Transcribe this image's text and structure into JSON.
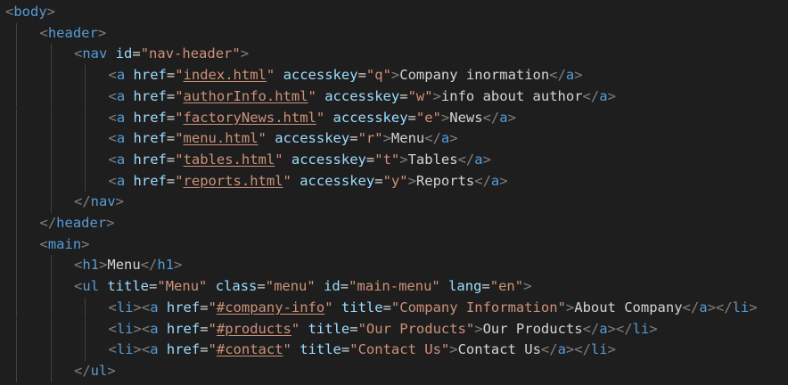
{
  "editor": {
    "theme_colors": {
      "background": "#1e1e1e",
      "bracket": "#808080",
      "tag": "#569cd6",
      "attribute": "#9cdcfe",
      "string": "#ce9178",
      "text": "#d4d4d4",
      "indent_guide": "#404040"
    },
    "lines": [
      {
        "indent": 0,
        "tokens": [
          [
            "b",
            "<"
          ],
          [
            "tag",
            "body"
          ],
          [
            "b",
            ">"
          ]
        ]
      },
      {
        "indent": 1,
        "tokens": [
          [
            "b",
            "<"
          ],
          [
            "tag",
            "header"
          ],
          [
            "b",
            ">"
          ]
        ]
      },
      {
        "indent": 2,
        "tokens": [
          [
            "b",
            "<"
          ],
          [
            "tag",
            "nav"
          ],
          [
            "text",
            " "
          ],
          [
            "attr",
            "id"
          ],
          [
            "text",
            "="
          ],
          [
            "str",
            "\"nav-header\""
          ],
          [
            "b",
            ">"
          ]
        ]
      },
      {
        "indent": 3,
        "tokens": [
          [
            "b",
            "<"
          ],
          [
            "tag",
            "a"
          ],
          [
            "text",
            " "
          ],
          [
            "attr",
            "href"
          ],
          [
            "text",
            "="
          ],
          [
            "str",
            "\""
          ],
          [
            "link",
            "index.html"
          ],
          [
            "str",
            "\""
          ],
          [
            "text",
            " "
          ],
          [
            "attr",
            "accesskey"
          ],
          [
            "text",
            "="
          ],
          [
            "str",
            "\"q\""
          ],
          [
            "b",
            ">"
          ],
          [
            "text",
            "Company inormation"
          ],
          [
            "b",
            "</"
          ],
          [
            "tag",
            "a"
          ],
          [
            "b",
            ">"
          ]
        ]
      },
      {
        "indent": 3,
        "tokens": [
          [
            "b",
            "<"
          ],
          [
            "tag",
            "a"
          ],
          [
            "text",
            " "
          ],
          [
            "attr",
            "href"
          ],
          [
            "text",
            "="
          ],
          [
            "str",
            "\""
          ],
          [
            "link",
            "authorInfo.html"
          ],
          [
            "str",
            "\""
          ],
          [
            "text",
            " "
          ],
          [
            "attr",
            "accesskey"
          ],
          [
            "text",
            "="
          ],
          [
            "str",
            "\"w\""
          ],
          [
            "b",
            ">"
          ],
          [
            "text",
            "info about author"
          ],
          [
            "b",
            "</"
          ],
          [
            "tag",
            "a"
          ],
          [
            "b",
            ">"
          ]
        ]
      },
      {
        "indent": 3,
        "tokens": [
          [
            "b",
            "<"
          ],
          [
            "tag",
            "a"
          ],
          [
            "text",
            " "
          ],
          [
            "attr",
            "href"
          ],
          [
            "text",
            "="
          ],
          [
            "str",
            "\""
          ],
          [
            "link",
            "factoryNews.html"
          ],
          [
            "str",
            "\""
          ],
          [
            "text",
            " "
          ],
          [
            "attr",
            "accesskey"
          ],
          [
            "text",
            "="
          ],
          [
            "str",
            "\"e\""
          ],
          [
            "b",
            ">"
          ],
          [
            "text",
            "News"
          ],
          [
            "b",
            "</"
          ],
          [
            "tag",
            "a"
          ],
          [
            "b",
            ">"
          ]
        ]
      },
      {
        "indent": 3,
        "tokens": [
          [
            "b",
            "<"
          ],
          [
            "tag",
            "a"
          ],
          [
            "text",
            " "
          ],
          [
            "attr",
            "href"
          ],
          [
            "text",
            "="
          ],
          [
            "str",
            "\""
          ],
          [
            "link",
            "menu.html"
          ],
          [
            "str",
            "\""
          ],
          [
            "text",
            " "
          ],
          [
            "attr",
            "accesskey"
          ],
          [
            "text",
            "="
          ],
          [
            "str",
            "\"r\""
          ],
          [
            "b",
            ">"
          ],
          [
            "text",
            "Menu"
          ],
          [
            "b",
            "</"
          ],
          [
            "tag",
            "a"
          ],
          [
            "b",
            ">"
          ]
        ]
      },
      {
        "indent": 3,
        "tokens": [
          [
            "b",
            "<"
          ],
          [
            "tag",
            "a"
          ],
          [
            "text",
            " "
          ],
          [
            "attr",
            "href"
          ],
          [
            "text",
            "="
          ],
          [
            "str",
            "\""
          ],
          [
            "link",
            "tables.html"
          ],
          [
            "str",
            "\""
          ],
          [
            "text",
            " "
          ],
          [
            "attr",
            "accesskey"
          ],
          [
            "text",
            "="
          ],
          [
            "str",
            "\"t\""
          ],
          [
            "b",
            ">"
          ],
          [
            "text",
            "Tables"
          ],
          [
            "b",
            "</"
          ],
          [
            "tag",
            "a"
          ],
          [
            "b",
            ">"
          ]
        ]
      },
      {
        "indent": 3,
        "tokens": [
          [
            "b",
            "<"
          ],
          [
            "tag",
            "a"
          ],
          [
            "text",
            " "
          ],
          [
            "attr",
            "href"
          ],
          [
            "text",
            "="
          ],
          [
            "str",
            "\""
          ],
          [
            "link",
            "reports.html"
          ],
          [
            "str",
            "\""
          ],
          [
            "text",
            " "
          ],
          [
            "attr",
            "accesskey"
          ],
          [
            "text",
            "="
          ],
          [
            "str",
            "\"y\""
          ],
          [
            "b",
            ">"
          ],
          [
            "text",
            "Reports"
          ],
          [
            "b",
            "</"
          ],
          [
            "tag",
            "a"
          ],
          [
            "b",
            ">"
          ]
        ]
      },
      {
        "indent": 2,
        "tokens": [
          [
            "b",
            "</"
          ],
          [
            "tag",
            "nav"
          ],
          [
            "b",
            ">"
          ]
        ]
      },
      {
        "indent": 1,
        "tokens": [
          [
            "b",
            "</"
          ],
          [
            "tag",
            "header"
          ],
          [
            "b",
            ">"
          ]
        ]
      },
      {
        "indent": 1,
        "tokens": [
          [
            "b",
            "<"
          ],
          [
            "tag",
            "main"
          ],
          [
            "b",
            ">"
          ]
        ]
      },
      {
        "indent": 2,
        "tokens": [
          [
            "b",
            "<"
          ],
          [
            "tag",
            "h1"
          ],
          [
            "b",
            ">"
          ],
          [
            "text",
            "Menu"
          ],
          [
            "b",
            "</"
          ],
          [
            "tag",
            "h1"
          ],
          [
            "b",
            ">"
          ]
        ]
      },
      {
        "indent": 2,
        "tokens": [
          [
            "b",
            "<"
          ],
          [
            "tag",
            "ul"
          ],
          [
            "text",
            " "
          ],
          [
            "attr",
            "title"
          ],
          [
            "text",
            "="
          ],
          [
            "str",
            "\"Menu\""
          ],
          [
            "text",
            " "
          ],
          [
            "attr",
            "class"
          ],
          [
            "text",
            "="
          ],
          [
            "str",
            "\"menu\""
          ],
          [
            "text",
            " "
          ],
          [
            "attr",
            "id"
          ],
          [
            "text",
            "="
          ],
          [
            "str",
            "\"main-menu\""
          ],
          [
            "text",
            " "
          ],
          [
            "attr",
            "lang"
          ],
          [
            "text",
            "="
          ],
          [
            "str",
            "\"en\""
          ],
          [
            "b",
            ">"
          ]
        ]
      },
      {
        "indent": 3,
        "tokens": [
          [
            "b",
            "<"
          ],
          [
            "tag",
            "li"
          ],
          [
            "b",
            "><"
          ],
          [
            "tag",
            "a"
          ],
          [
            "text",
            " "
          ],
          [
            "attr",
            "href"
          ],
          [
            "text",
            "="
          ],
          [
            "str",
            "\""
          ],
          [
            "link",
            "#company-info"
          ],
          [
            "str",
            "\""
          ],
          [
            "text",
            " "
          ],
          [
            "attr",
            "title"
          ],
          [
            "text",
            "="
          ],
          [
            "str",
            "\"Company Information\""
          ],
          [
            "b",
            ">"
          ],
          [
            "text",
            "About Company"
          ],
          [
            "b",
            "</"
          ],
          [
            "tag",
            "a"
          ],
          [
            "b",
            "></"
          ],
          [
            "tag",
            "li"
          ],
          [
            "b",
            ">"
          ]
        ]
      },
      {
        "indent": 3,
        "tokens": [
          [
            "b",
            "<"
          ],
          [
            "tag",
            "li"
          ],
          [
            "b",
            "><"
          ],
          [
            "tag",
            "a"
          ],
          [
            "text",
            " "
          ],
          [
            "attr",
            "href"
          ],
          [
            "text",
            "="
          ],
          [
            "str",
            "\""
          ],
          [
            "link",
            "#products"
          ],
          [
            "str",
            "\""
          ],
          [
            "text",
            " "
          ],
          [
            "attr",
            "title"
          ],
          [
            "text",
            "="
          ],
          [
            "str",
            "\"Our Products\""
          ],
          [
            "b",
            ">"
          ],
          [
            "text",
            "Our Products"
          ],
          [
            "b",
            "</"
          ],
          [
            "tag",
            "a"
          ],
          [
            "b",
            "></"
          ],
          [
            "tag",
            "li"
          ],
          [
            "b",
            ">"
          ]
        ]
      },
      {
        "indent": 3,
        "tokens": [
          [
            "b",
            "<"
          ],
          [
            "tag",
            "li"
          ],
          [
            "b",
            "><"
          ],
          [
            "tag",
            "a"
          ],
          [
            "text",
            " "
          ],
          [
            "attr",
            "href"
          ],
          [
            "text",
            "="
          ],
          [
            "str",
            "\""
          ],
          [
            "link",
            "#contact"
          ],
          [
            "str",
            "\""
          ],
          [
            "text",
            " "
          ],
          [
            "attr",
            "title"
          ],
          [
            "text",
            "="
          ],
          [
            "str",
            "\"Contact Us\""
          ],
          [
            "b",
            ">"
          ],
          [
            "text",
            "Contact Us"
          ],
          [
            "b",
            "</"
          ],
          [
            "tag",
            "a"
          ],
          [
            "b",
            "></"
          ],
          [
            "tag",
            "li"
          ],
          [
            "b",
            ">"
          ]
        ]
      },
      {
        "indent": 2,
        "tokens": [
          [
            "b",
            "</"
          ],
          [
            "tag",
            "ul"
          ],
          [
            "b",
            ">"
          ]
        ]
      }
    ]
  }
}
